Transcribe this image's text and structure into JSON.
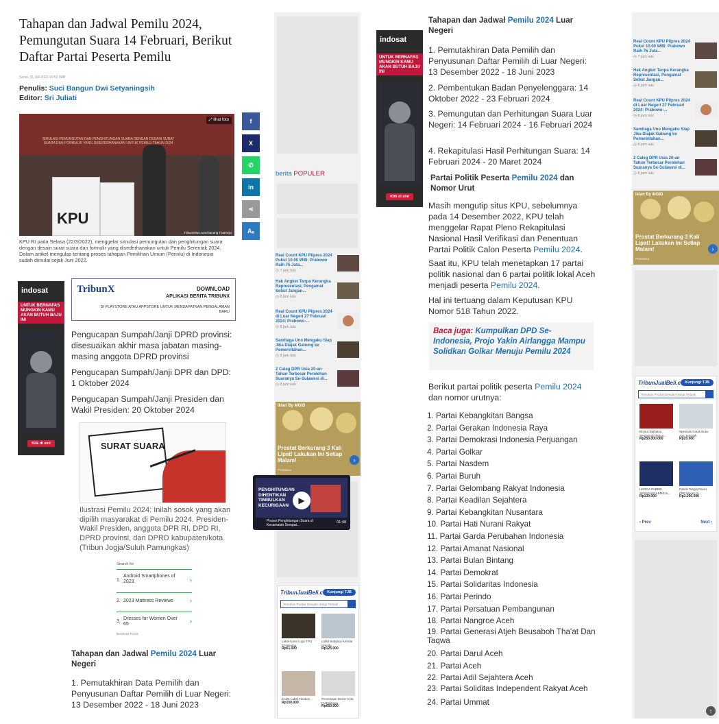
{
  "left_article": {
    "title": "Tahapan dan Jadwal Pemilu 2024, Pemungutan Suara 14 Februari, Berikut Daftar Partai Peserta Pemilu",
    "date": "Senin, 31 Juli 2023 10:52 WIB",
    "author_label": "Penulis:",
    "author": "Suci Bangun Dwi Setyaningsih",
    "editor_label": "Editor:",
    "editor": "Sri Juliati",
    "photo_button": "lihat foto",
    "photo_sign": "KPU",
    "photo_credit": "Tribunnews.com/Danang Triatmojo",
    "caption": "KPU RI pada Selasa (22/3/2022), menggelar simulasi pemungutan dan penghitungan suara dengan desain surat suara dan formulir yang disederhanakan untuk Pemilu Serentak 2024. Dalam artikel mengulas tentang proses tahapan Pemilihan Umum (Pemilu) di Indonesia sudah dimulai sejak Juni 2022.",
    "share": [
      "f",
      "X",
      "W",
      "in",
      "<",
      "A"
    ],
    "tribunx": {
      "brand": "TribunX",
      "download": "DOWNLOAD",
      "app": "APLIKASI BERITA TRIBUNX",
      "store": "DI PLAYSTORE ATAU APPSTORE UNTUK MENDAPATKAN PENGALAMAN BARU"
    },
    "paragraphs": [
      "Pengucapan Sumpah/Janji DPRD provinsi: disesuaikan akhir masa jabatan masing-masing anggota DPRD provinsi",
      "Pengucapan Sumpah/Janji DPR dan DPD: 1 Oktober 2024",
      "Pengucapan Sumpah/Janji Presiden dan Wakil Presiden: 20 Oktober 2024"
    ],
    "illustration_text": "SURAT SUARA",
    "illustration_caption": "Ilustrasi Pemilu 2024: Inilah sosok yang akan dipilih masyarakat di Pemilu 2024. Presiden-Wakil Presiden, anggota DPR RI, DPD RI, DPRD provinsi, dan DPRD kabupaten/kota. (Tribun Jogja/Suluh Pamungkas)",
    "search": {
      "label": "Search for",
      "items": [
        {
          "n": "1.",
          "t": "Android Smartphones of 2023"
        },
        {
          "n": "2.",
          "t": "2023 Mattress Reviews"
        },
        {
          "n": "3.",
          "t": "Dresses for Women Over 65"
        }
      ],
      "footer": "Business Focus"
    },
    "sect_pre": "Tahapan dan Jadwal",
    "sect_kw": "Pemilu 2024",
    "sect_post": "Luar Negeri",
    "sect_item1": "1. Pemutakhiran Data Pemilih dan Penyusunan Daftar Pemilih di Luar Negeri: 13 Desember 2022 - 18 Juni 2023"
  },
  "indosat": {
    "logo": "indosat",
    "slogan": "UNTUK BERNAFAS MUNGKIN KAMU AKAN BUTUH BAJU INI",
    "button": "Klik di sini"
  },
  "left_sidebar": {
    "popular_a": "berita",
    "popular_b": "POPULER",
    "news": [
      {
        "t": "Real Count KPU Pilpres 2024 Pukul 10.00 WIB: Prabowo Raih 75 Juta...",
        "time": "7 jam lalu"
      },
      {
        "t": "Hak Angket Tanpa Kerangka Representasi, Pengamat Sebut Jangan...",
        "time": "8 jam lalu"
      },
      {
        "t": "Real Count KPU Pilpres 2024 di Luar Negeri 27 Februari 2024: Prabowo-...",
        "time": "8 jam lalu"
      },
      {
        "t": "Sandiaga Uno Mengaku Siap Jika Diajak Gabung ke Pemerintahan...",
        "time": "8 jam lalu"
      },
      {
        "t": "2 Caleg DPR Usia 20-an Tahun Terbesar Perolehan Suaranya Se-Sulawesi di...",
        "time": "8 jam lalu"
      }
    ],
    "ad_tag": "Iklan By MGID",
    "ad_headline": "Prostat Berkurang 3 Kali Lipat! Lakukan Ini Setiap Malam!",
    "ad_src": "Prostaaca",
    "shop": {
      "brand": "TribunJualBeli.com",
      "tag": "Kunjungi TJB",
      "search_ph": "Temukan Produk Dengan Harga Terbaik",
      "products": [
        {
          "name": "Label Kamt Logo TPU 3D Bening",
          "price": "Rp61.000"
        },
        {
          "name": "Label Babyboy Kendal Omnifu...",
          "price": "Rp125.000"
        },
        {
          "name": "Cetak Label Fitiuban...",
          "price": "Rp150.000"
        },
        {
          "name": "Persewaan Drone Kota Purbalingga...",
          "price": "Rp650.000"
        }
      ]
    }
  },
  "video": {
    "title": "PENGHITUNGAN DIHENTIKAN TIMBULKAN KECURIGAAN",
    "caption": "Proses Penghitungan Suara di Kecamatan Sempat...",
    "duration": "01:48"
  },
  "right_article": {
    "sect_pre": "Tahapan dan Jadwal",
    "sect_kw": "Pemilu 2024",
    "sect_post": "Luar Negeri",
    "items": [
      "1. Pemutakhiran Data Pemilih dan Penyusunan Daftar Pemilih di Luar Negeri: 13 Desember 2022 - 18 Juni 2023",
      "2. Pembentukan Badan Penyelenggara: 14 Oktober 2022 - 23 Februari 2024",
      "3. Pemungutan dan Perhitungan Suara Luar Negeri: 14 Februari 2024 - 16 Februari 2024",
      "4. Rekapitulasi Hasil Perhitungan Suara: 14 Februari 2024 - 20 Maret 2024"
    ],
    "sect2_pre": "Partai Politik Peserta",
    "sect2_kw": "Pemilu 2024",
    "sect2_post": "dan Nomor Urut",
    "p1_a": "Masih mengutip situs KPU, sebelumnya pada 14 Desember 2022, KPU telah menggelar Rapat Pleno Rekapitulasi Nasional Hasil Verifikasi dan Penentuan Partai Politik Calon Peserta",
    "p1_kw": "Pemilu 2024",
    "p1_b": ".",
    "p2_a": "Saat itu, KPU telah menetapkan 17 partai politik nasional dan 6 partai politik lokal Aceh menjadi peserta",
    "p2_kw": "Pemilu 2024",
    "p2_b": ".",
    "p3": "Hal ini tertuang dalam Keputusan KPU Nomor 518 Tahun 2022.",
    "baca_label": "Baca juga:",
    "baca_link": "Kumpulkan DPD Se-Indonesia, Projo Yakin Airlangga Mampu Solidkan Golkar Menuju Pemilu 2024",
    "p4_a": "Berikut partai politik peserta",
    "p4_kw": "Pemilu 2024",
    "p4_b": "dan nomor urutnya:",
    "parties": [
      "1. Partai Kebangkitan Bangsa",
      "2. Partai Gerakan Indonesia Raya",
      "3. Partai Demokrasi Indonesia Perjuangan",
      "4. Partai Golkar",
      "5. Partai Nasdem",
      "6. Partai Buruh",
      "7. Partai Gelombang Rakyat Indonesia",
      "8. Partai Keadilan Sejahtera",
      "9. Partai Kebangkitan Nusantara",
      "10. Partai Hati Nurani Rakyat",
      "11. Partai Garda Perubahan Indonesia",
      "12. Partai Amanat Nasional",
      "13. Partai Bulan Bintang",
      "14. Partai Demokrat",
      "15. Partai Solidaritas Indonesia",
      "16. Partai Perindo",
      "17. Partai Persatuan Pembangunan",
      "18. Partai Nangroe Aceh",
      "19. Partai Generasi Atjeh Beusaboh Tha'at Dan Taqwa",
      "20. Partai Darul Aceh",
      "21. Partai Aceh",
      "22. Partai Adil Sejahtera Aceh",
      "23. Partai Soliditas Independent Rakyat Aceh",
      "24. Partai Ummat"
    ]
  },
  "right_sidebar": {
    "news": [
      {
        "t": "Real Count KPU Pilpres 2024 Pukul 10.00 WIB: Prabowo Raih 75 Juta...",
        "time": "7 jam lalu"
      },
      {
        "t": "Hak Angket Tanpa Kerangka Representasi, Pengamat Sebut Jangan...",
        "time": "8 jam lalu"
      },
      {
        "t": "Real Count KPU Pilpres 2024 di Luar Negeri 27 Februari 2024: Prabowo-...",
        "time": "8 jam lalu"
      },
      {
        "t": "Sandiaga Uno Mengaku Siap Jika Diajak Gabung ke Pemerintahan...",
        "time": "8 jam lalu"
      },
      {
        "t": "2 Caleg DPR Usia 20-an Tahun Terbesar Perolehan Suaranya Se-Sulawesi di...",
        "time": "8 jam lalu"
      }
    ],
    "ad_tag": "Iklan By MGID",
    "ad_headline": "Prostat Berkurang 3 Kali Lipat! Lakukan Ini Setiap Malam!",
    "ad_src": "Prostaaca",
    "shop": {
      "brand": "TribunJualBeli.com",
      "tag": "Kunjungi TJB",
      "search_ph": "Temukan Produk Dengan Harga Terbaik",
      "products": [
        {
          "name": "Brosur Daihatsu Semarindo Tahun...",
          "price": "Rp250.000.000"
        },
        {
          "name": "Spesialis Cetak Buku Ajar Sekolah",
          "price": "Rp25.000"
        },
        {
          "name": "HARGA PABRIK SERAGAM KEMEJA...",
          "price": "Rp130.000"
        },
        {
          "name": "Pabrik Tangki Panel FRP Murah Di...",
          "price": "Rp3.200.000"
        }
      ],
      "prev": "Prev",
      "next": "Next"
    }
  },
  "colors": {
    "link": "#1f6fb4",
    "red": "#c2183b",
    "fb": "#3b5998",
    "x": "#1d2a6b",
    "wa": "#25d366",
    "li": "#0e76a8",
    "grey": "#9a9a9a",
    "font": "#2f7bbf"
  }
}
